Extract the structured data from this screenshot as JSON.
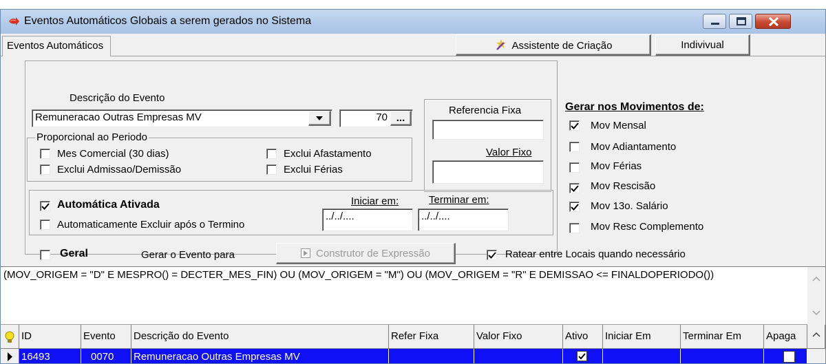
{
  "window": {
    "title": "Eventos Automáticos Globais a serem gerados no Sistema",
    "icon": "red-arrow-icon"
  },
  "tabs": [
    {
      "label": "Eventos Automáticos",
      "selected": true
    }
  ],
  "toolbar": {
    "wizard_label": "Assistente de Criação",
    "individual_label": "Indivivual"
  },
  "form": {
    "descricao_label": "Descrição do Evento",
    "descricao_value": "Remuneracao Outras Empresas MV",
    "codigo_value": "70",
    "ellipsis": "...",
    "proporcional": {
      "title": "Proporcional ao Periodo",
      "mes_comercial": {
        "label": "Mes Comercial (30 dias)",
        "checked": false
      },
      "exclui_afastamento": {
        "label": "Exclui Afastamento",
        "checked": false
      },
      "exclui_admissao": {
        "label": "Exclui Admissao/Demissão",
        "checked": false
      },
      "exclui_ferias": {
        "label": "Exclui Férias",
        "checked": false
      }
    },
    "referencia_label": "Referencia Fixa",
    "referencia_value": "",
    "valor_label": "Valor Fixo",
    "valor_value": "",
    "automatica": {
      "label": "Automática Ativada",
      "checked": true
    },
    "auto_excluir": {
      "label": "Automaticamente Excluir após o Termino",
      "checked": false
    },
    "iniciar_label": "Iniciar em:",
    "iniciar_value": "../../....",
    "terminar_label": "Terminar em:",
    "terminar_value": "../../....",
    "geral": {
      "label": "Geral",
      "checked": false
    },
    "gerar_para_label": "Gerar o Evento para",
    "construtor_label": "Construtor de Expressão",
    "ratear": {
      "label": "Ratear entre Locais quando necessário",
      "checked": true
    }
  },
  "movimentos": {
    "title": "Gerar nos Movimentos de:",
    "items": [
      {
        "label": "Mov Mensal",
        "checked": true
      },
      {
        "label": "Mov Adiantamento",
        "checked": false
      },
      {
        "label": "Mov Férias",
        "checked": false
      },
      {
        "label": "Mov Rescisão",
        "checked": true
      },
      {
        "label": "Mov 13o. Salário",
        "checked": true
      },
      {
        "label": "Mov Resc Complemento",
        "checked": false
      }
    ]
  },
  "expression": "(MOV_ORIGEM = \"D\" E MESPRO() = DECTER_MES_FIN) OU (MOV_ORIGEM = \"M\") OU (MOV_ORIGEM = \"R\" E DEMISSAO <= FINALDOPERIODO())",
  "grid": {
    "columns": [
      "ID",
      "Evento",
      "Descrição do Evento",
      "Refer Fixa",
      "Valor Fixo",
      "Ativo",
      "Iniciar Em",
      "Terminar Em",
      "Apaga"
    ],
    "rows": [
      {
        "id": "16493",
        "evento": "0070",
        "descricao": "Remuneracao Outras Empresas MV",
        "refer": "",
        "valor": "",
        "ativo": true,
        "iniciar": "",
        "terminar": "",
        "apaga": false
      }
    ]
  },
  "colors": {
    "selection": "#1010f8",
    "title_gradient_top": "#c7d9f0",
    "close_red": "#c94a33"
  }
}
